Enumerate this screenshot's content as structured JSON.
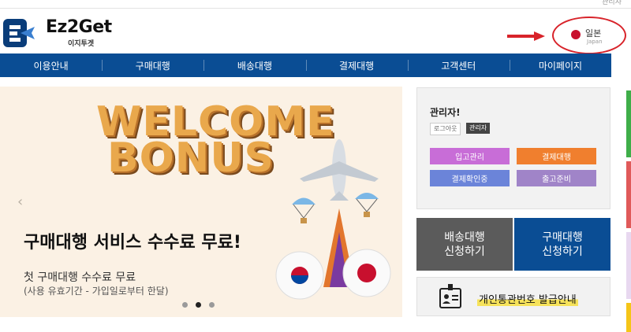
{
  "top": {
    "link": "관리자"
  },
  "logo": {
    "text": "Ez2Get",
    "sub": "이지투겟",
    "mark_icon": "ez2get-logo-icon"
  },
  "country": {
    "name": "일본",
    "sub": "Japan",
    "flag_color": "#c8102e",
    "highlight_color": "#d8232a"
  },
  "nav": {
    "items": [
      {
        "label": "이용안내"
      },
      {
        "label": "구매대행"
      },
      {
        "label": "배송대행"
      },
      {
        "label": "결제대행"
      },
      {
        "label": "고객센터"
      },
      {
        "label": "마이페이지"
      }
    ],
    "color": "#0a4d94"
  },
  "banner": {
    "welcome": "WELCOME",
    "bonus": "BONUS",
    "headline": "구매대행 서비스 수수료 무료!",
    "sub1": "첫 구매대행 수수료 무료",
    "sub2": "(사용 유효기간 - 가입일로부터 한달)",
    "slides": 3,
    "active_slide": 2
  },
  "admin": {
    "title": "관리자!",
    "logout": "로그아웃",
    "role": "관리자",
    "buttons": [
      {
        "label": "입고관리",
        "color": "#c86dd7"
      },
      {
        "label": "결제대행",
        "color": "#f07f2e"
      },
      {
        "label": "결제확인중",
        "color": "#6b84d9"
      },
      {
        "label": "출고준비",
        "color": "#a084c8"
      }
    ]
  },
  "services": {
    "shipping": {
      "line1": "배송대행",
      "line2": "신청하기"
    },
    "purchase": {
      "line1": "구매대행",
      "line2": "신청하기"
    }
  },
  "customs": {
    "label": "개인통관번호 발급안내",
    "icon": "id-card-icon"
  }
}
